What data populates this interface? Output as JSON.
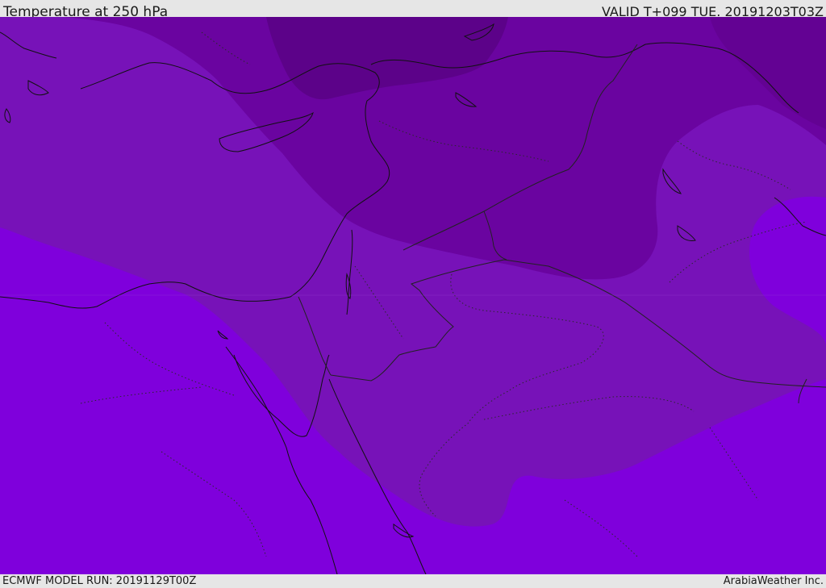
{
  "header": {
    "title": "Temperature at 250 hPa",
    "valid": "VALID T+099 TUE. 20191203T03Z"
  },
  "footer": {
    "model_run": "ECMWF MODEL RUN: 20191129T00Z",
    "credit": "ArabiaWeather Inc."
  },
  "map": {
    "colors": {
      "band_warm": "#7f00dc",
      "band_mid": "#7712b8",
      "band_cool": "#6a04a0",
      "band_cold": "#5c0289",
      "coastline": "#111111",
      "border": "#222222"
    }
  }
}
